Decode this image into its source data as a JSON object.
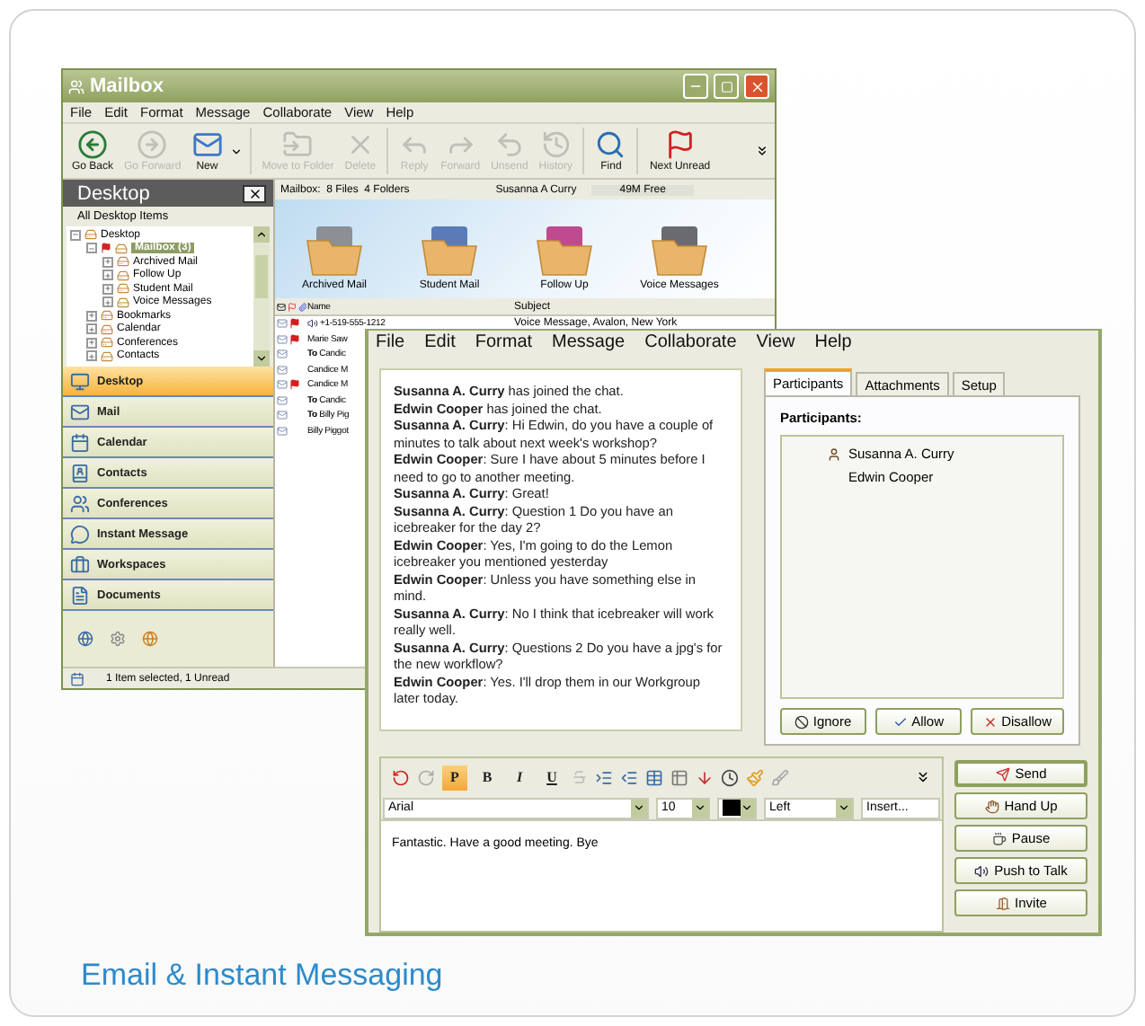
{
  "mailbox_window": {
    "title": "Mailbox",
    "menu": [
      "File",
      "Edit",
      "Format",
      "Message",
      "Collaborate",
      "View",
      "Help"
    ],
    "toolbar": [
      {
        "kind": "back",
        "label": "Go Back",
        "disabled": false
      },
      {
        "kind": "forward",
        "label": "Go Forward",
        "disabled": true
      },
      {
        "kind": "new",
        "label": "New",
        "disabled": false
      },
      {
        "kind": "move",
        "label": "Move to Folder",
        "disabled": true
      },
      {
        "kind": "delete",
        "label": "Delete",
        "disabled": true
      },
      {
        "kind": "reply",
        "label": "Reply",
        "disabled": true
      },
      {
        "kind": "forward-mail",
        "label": "Forward",
        "disabled": true
      },
      {
        "kind": "unsend",
        "label": "Unsend",
        "disabled": true
      },
      {
        "kind": "history",
        "label": "History",
        "disabled": true
      },
      {
        "kind": "find",
        "label": "Find",
        "disabled": false
      },
      {
        "kind": "next",
        "label": "Next Unread",
        "disabled": false
      }
    ],
    "desktop_pane": {
      "title": "Desktop",
      "subtitle": "All Desktop Items",
      "tree": [
        {
          "label": "Desktop",
          "expanded": true,
          "selected": false,
          "children": [
            {
              "label": "Mailbox (3)",
              "expanded": true,
              "selected": true,
              "children": [
                {
                  "label": "Archived Mail",
                  "expanded": false,
                  "selected": false
                },
                {
                  "label": "Follow Up",
                  "expanded": false,
                  "selected": false
                },
                {
                  "label": "Student Mail",
                  "expanded": false,
                  "selected": false
                },
                {
                  "label": "Voice Messages",
                  "expanded": false,
                  "selected": false
                }
              ]
            },
            {
              "label": "Bookmarks",
              "expanded": false,
              "selected": false
            },
            {
              "label": "Calendar",
              "expanded": false,
              "selected": false
            },
            {
              "label": "Conferences",
              "expanded": false,
              "selected": false
            },
            {
              "label": "Contacts",
              "expanded": false,
              "selected": false
            }
          ]
        }
      ],
      "nav": [
        {
          "kind": "desktop",
          "label": "Desktop",
          "selected": true
        },
        {
          "kind": "mail",
          "label": "Mail",
          "selected": false
        },
        {
          "kind": "calendar",
          "label": "Calendar",
          "selected": false
        },
        {
          "kind": "contacts",
          "label": "Contacts",
          "selected": false
        },
        {
          "kind": "conferences",
          "label": "Conferences",
          "selected": false
        },
        {
          "kind": "im",
          "label": "Instant Message",
          "selected": false
        },
        {
          "kind": "workspaces",
          "label": "Workspaces",
          "selected": false
        },
        {
          "kind": "documents",
          "label": "Documents",
          "selected": false
        }
      ]
    },
    "info_bar": {
      "location": "Mailbox:  8 Files  4 Folders",
      "user": "Susanna A Curry",
      "free": "49M Free"
    },
    "folders": [
      "Archived Mail",
      "Student Mail",
      "Follow Up",
      "Voice Messages"
    ],
    "columns": [
      "Name",
      "Subject"
    ],
    "rows": [
      {
        "kind": "voice",
        "name": "+1-519-555-1212",
        "subject": "Voice Message, Avalon, New York",
        "flagged": true
      },
      {
        "kind": "mail",
        "name": "Marie Saw",
        "flagged": true
      },
      {
        "kind": "mail",
        "name": "**To** Candic",
        "flagged": false
      },
      {
        "kind": "mail",
        "name": "Candice M",
        "flagged": false
      },
      {
        "kind": "mail",
        "name": "Candice M",
        "flagged": true
      },
      {
        "kind": "mail",
        "name": "**To** Candic",
        "flagged": false
      },
      {
        "kind": "mail",
        "name": "**To** Billy Pig",
        "flagged": false
      },
      {
        "kind": "mail",
        "name": "Billy Piggot",
        "flagged": false
      }
    ],
    "status": "1 Item selected, 1 Unread"
  },
  "chat_window": {
    "menu": [
      "File",
      "Edit",
      "Format",
      "Message",
      "Collaborate",
      "View",
      "Help"
    ],
    "messages": [
      "**Susanna A. Curry** has joined the chat.",
      "**Edwin Cooper** has joined the chat.",
      "**Susanna A. Curry**: Hi Edwin, do you have a couple of minutes to talk about next week's workshop?",
      "**Edwin Cooper**: Sure I have about 5 minutes before I need to go to another meeting.",
      "**Susanna A. Curry**: Great!",
      "**Susanna A. Curry**: Question 1 Do you have an icebreaker for the day 2?",
      "**Edwin Cooper**: Yes, I'm going to do the Lemon icebreaker you mentioned yesterday",
      "**Edwin Cooper**: Unless you have something else in mind.",
      "**Susanna A. Curry**: No I think that icebreaker will work really well.",
      "**Susanna A. Curry**: Questions 2 Do you have a jpg's for the new workflow?",
      "**Edwin Cooper**: Yes. I'll drop them in our Workgroup later today."
    ],
    "tabs": [
      {
        "label": "Participants",
        "selected": true
      },
      {
        "label": "Attachments",
        "selected": false
      },
      {
        "label": "Setup",
        "selected": false
      }
    ],
    "participants_label": "Participants:",
    "participants": [
      {
        "name": "Susanna A. Curry",
        "host": true
      },
      {
        "name": "Edwin Cooper",
        "host": false
      }
    ],
    "participant_buttons": [
      "Ignore",
      "Allow",
      "Disallow"
    ],
    "format_buttons": [
      {
        "label": "P",
        "selected": true
      },
      {
        "label": "B",
        "selected": false
      },
      {
        "label": "I",
        "selected": false
      },
      {
        "label": "U",
        "selected": false
      }
    ],
    "font": "Arial",
    "size": "10",
    "align": "Left",
    "insert": "Insert...",
    "compose": "Fantastic. Have a good meeting. Bye",
    "side_buttons": [
      {
        "kind": "send",
        "label": "Send"
      },
      {
        "kind": "hand",
        "label": "Hand Up"
      },
      {
        "kind": "pause",
        "label": "Pause"
      },
      {
        "kind": "talk",
        "label": "Push to Talk"
      },
      {
        "kind": "invite",
        "label": "Invite"
      }
    ]
  },
  "caption": "Email & Instant Messaging"
}
